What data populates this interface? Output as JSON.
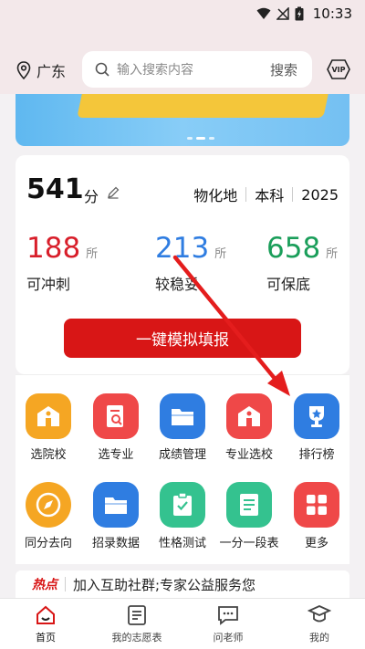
{
  "status_bar": {
    "time": "10:33",
    "icons": [
      "wifi-icon",
      "no-signal-icon",
      "battery-charging-icon"
    ]
  },
  "header": {
    "location": "广东",
    "search_placeholder": "输入搜索内容",
    "search_button": "搜索",
    "vip_label": "VIP"
  },
  "score_card": {
    "score": "541",
    "score_unit": "分",
    "subjects": "物化地",
    "track": "本科",
    "year": "2025",
    "stats": [
      {
        "count": "188",
        "suffix": "所",
        "label": "可冲刺",
        "color": "#d81e2a"
      },
      {
        "count": "213",
        "suffix": "所",
        "label": "较稳妥",
        "color": "#2f7de1"
      },
      {
        "count": "658",
        "suffix": "所",
        "label": "可保底",
        "color": "#1a9e5a"
      }
    ],
    "cta_label": "一键模拟填报"
  },
  "grid": [
    {
      "label": "选院校",
      "icon": "school-icon",
      "color": "#f5a623"
    },
    {
      "label": "选专业",
      "icon": "book-search-icon",
      "color": "#ef4848"
    },
    {
      "label": "成绩管理",
      "icon": "folder-icon",
      "color": "#2f7de1"
    },
    {
      "label": "专业选校",
      "icon": "school-icon",
      "color": "#ef4848"
    },
    {
      "label": "排行榜",
      "icon": "trophy-icon",
      "color": "#2f7de1"
    },
    {
      "label": "同分去向",
      "icon": "compass-icon",
      "color": "#f5a623"
    },
    {
      "label": "招录数据",
      "icon": "folder-icon",
      "color": "#2f7de1"
    },
    {
      "label": "性格测试",
      "icon": "clipboard-check-icon",
      "color": "#34c28f"
    },
    {
      "label": "一分一段表",
      "icon": "document-icon",
      "color": "#34c28f"
    },
    {
      "label": "更多",
      "icon": "grid-more-icon",
      "color": "#ef4848"
    }
  ],
  "news": {
    "tag": "热点",
    "text": "加入互助社群;专家公益服务您"
  },
  "bottom_nav": [
    {
      "label": "首页",
      "icon": "home-icon",
      "active": true
    },
    {
      "label": "我的志愿表",
      "icon": "list-icon",
      "active": false
    },
    {
      "label": "问老师",
      "icon": "chat-icon",
      "active": false
    },
    {
      "label": "我的",
      "icon": "graduate-icon",
      "active": false
    }
  ],
  "colors": {
    "brand_red": "#d81616",
    "background": "#f3f1f3"
  }
}
